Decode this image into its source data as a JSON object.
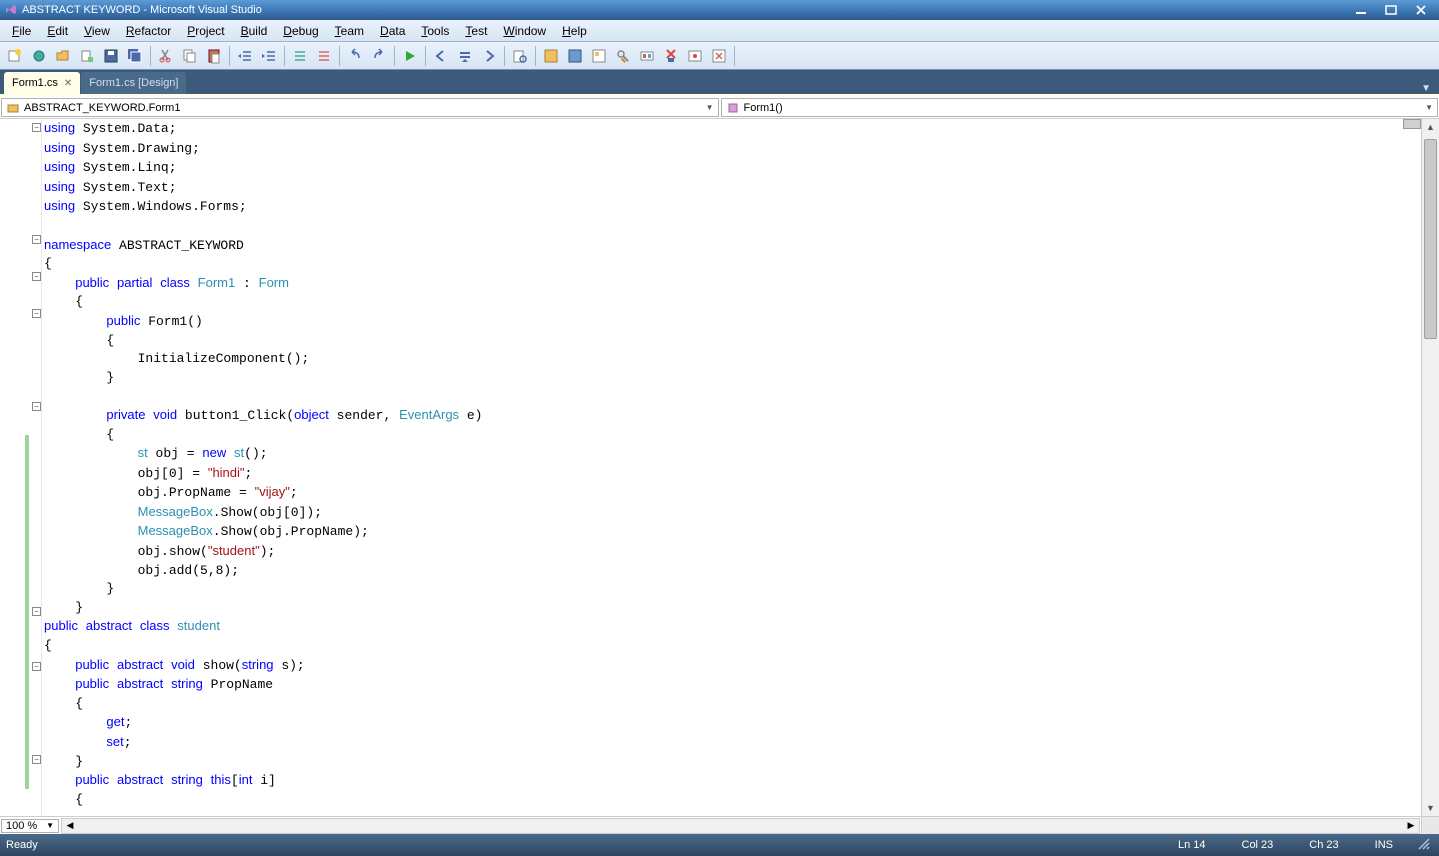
{
  "titlebar": {
    "title": "ABSTRACT KEYWORD - Microsoft Visual Studio"
  },
  "menu": {
    "items": [
      "File",
      "Edit",
      "View",
      "Refactor",
      "Project",
      "Build",
      "Debug",
      "Team",
      "Data",
      "Tools",
      "Test",
      "Window",
      "Help"
    ]
  },
  "tabs": {
    "active": "Form1.cs",
    "inactive": "Form1.cs [Design]"
  },
  "nav": {
    "left_label": "ABSTRACT_KEYWORD.Form1",
    "right_label": "Form1()"
  },
  "zoom": {
    "value": "100 %"
  },
  "status": {
    "ready": "Ready",
    "ln": "Ln 14",
    "col": "Col 23",
    "ch": "Ch 23",
    "ins": "INS"
  },
  "code_tokens": [
    [
      [
        "kw",
        "using"
      ],
      [
        "",
        " System.Data;"
      ]
    ],
    [
      [
        "kw",
        "using"
      ],
      [
        "",
        " System.Drawing;"
      ]
    ],
    [
      [
        "kw",
        "using"
      ],
      [
        "",
        " System.Linq;"
      ]
    ],
    [
      [
        "kw",
        "using"
      ],
      [
        "",
        " System.Text;"
      ]
    ],
    [
      [
        "kw",
        "using"
      ],
      [
        "",
        " System.Windows.Forms;"
      ]
    ],
    [
      [
        "",
        ""
      ]
    ],
    [
      [
        "kw",
        "namespace"
      ],
      [
        "",
        " ABSTRACT_KEYWORD"
      ]
    ],
    [
      [
        "",
        "{"
      ]
    ],
    [
      [
        "",
        "    "
      ],
      [
        "kw",
        "public"
      ],
      [
        "",
        " "
      ],
      [
        "kw",
        "partial"
      ],
      [
        "",
        " "
      ],
      [
        "kw",
        "class"
      ],
      [
        "",
        " "
      ],
      [
        "typ",
        "Form1"
      ],
      [
        "",
        " : "
      ],
      [
        "typ",
        "Form"
      ]
    ],
    [
      [
        "",
        "    {"
      ]
    ],
    [
      [
        "",
        "        "
      ],
      [
        "kw",
        "public"
      ],
      [
        "",
        " Form1()"
      ]
    ],
    [
      [
        "",
        "        {"
      ]
    ],
    [
      [
        "",
        "            InitializeComponent();"
      ]
    ],
    [
      [
        "",
        "        }"
      ]
    ],
    [
      [
        "",
        ""
      ]
    ],
    [
      [
        "",
        "        "
      ],
      [
        "kw",
        "private"
      ],
      [
        "",
        " "
      ],
      [
        "kw",
        "void"
      ],
      [
        "",
        " button1_Click("
      ],
      [
        "kw",
        "object"
      ],
      [
        "",
        " sender, "
      ],
      [
        "typ",
        "EventArgs"
      ],
      [
        "",
        " e)"
      ]
    ],
    [
      [
        "",
        "        {"
      ]
    ],
    [
      [
        "",
        "            "
      ],
      [
        "typ",
        "st"
      ],
      [
        "",
        " obj = "
      ],
      [
        "kw",
        "new"
      ],
      [
        "",
        " "
      ],
      [
        "typ",
        "st"
      ],
      [
        "",
        "();"
      ]
    ],
    [
      [
        "",
        "            obj[0] = "
      ],
      [
        "str",
        "\"hindi\""
      ],
      [
        "",
        ";"
      ]
    ],
    [
      [
        "",
        "            obj.PropName = "
      ],
      [
        "str",
        "\"vijay\""
      ],
      [
        "",
        ";"
      ]
    ],
    [
      [
        "",
        "            "
      ],
      [
        "typ",
        "MessageBox"
      ],
      [
        "",
        ".Show(obj[0]);"
      ]
    ],
    [
      [
        "",
        "            "
      ],
      [
        "typ",
        "MessageBox"
      ],
      [
        "",
        ".Show(obj.PropName);"
      ]
    ],
    [
      [
        "",
        "            obj.show("
      ],
      [
        "str",
        "\"student\""
      ],
      [
        "",
        ");"
      ]
    ],
    [
      [
        "",
        "            obj.add(5,8);"
      ]
    ],
    [
      [
        "",
        "        }"
      ]
    ],
    [
      [
        "",
        "    }"
      ]
    ],
    [
      [
        "kw",
        "public"
      ],
      [
        "",
        " "
      ],
      [
        "kw",
        "abstract"
      ],
      [
        "",
        " "
      ],
      [
        "kw",
        "class"
      ],
      [
        "",
        " "
      ],
      [
        "typ",
        "student"
      ]
    ],
    [
      [
        "",
        "{"
      ]
    ],
    [
      [
        "",
        "    "
      ],
      [
        "kw",
        "public"
      ],
      [
        "",
        " "
      ],
      [
        "kw",
        "abstract"
      ],
      [
        "",
        " "
      ],
      [
        "kw",
        "void"
      ],
      [
        "",
        " show("
      ],
      [
        "kw",
        "string"
      ],
      [
        "",
        " s);"
      ]
    ],
    [
      [
        "",
        "    "
      ],
      [
        "kw",
        "public"
      ],
      [
        "",
        " "
      ],
      [
        "kw",
        "abstract"
      ],
      [
        "",
        " "
      ],
      [
        "kw",
        "string"
      ],
      [
        "",
        " PropName"
      ]
    ],
    [
      [
        "",
        "    {"
      ]
    ],
    [
      [
        "",
        "        "
      ],
      [
        "kw",
        "get"
      ],
      [
        "",
        ";"
      ]
    ],
    [
      [
        "",
        "        "
      ],
      [
        "kw",
        "set"
      ],
      [
        "",
        ";"
      ]
    ],
    [
      [
        "",
        "    }"
      ]
    ],
    [
      [
        "",
        "    "
      ],
      [
        "kw",
        "public"
      ],
      [
        "",
        " "
      ],
      [
        "kw",
        "abstract"
      ],
      [
        "",
        " "
      ],
      [
        "kw",
        "string"
      ],
      [
        "",
        " "
      ],
      [
        "kw",
        "this"
      ],
      [
        "",
        "["
      ],
      [
        "kw",
        "int"
      ],
      [
        "",
        " i]"
      ]
    ],
    [
      [
        "",
        "    {"
      ]
    ]
  ],
  "outline_toggles": [
    0,
    6,
    8,
    10,
    15,
    26,
    29,
    34
  ],
  "change_bars": [
    [
      17,
      24
    ],
    [
      25,
      26
    ],
    [
      27,
      35
    ]
  ]
}
